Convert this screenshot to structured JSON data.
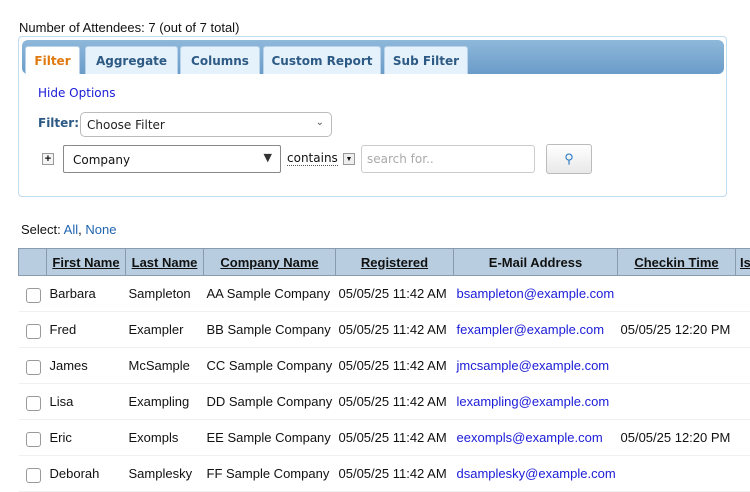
{
  "count_text": "Number of Attendees: 7 (out of 7 total)",
  "tabs": [
    {
      "label": "Filter",
      "active": true
    },
    {
      "label": "Aggregate"
    },
    {
      "label": "Columns"
    },
    {
      "label": "Custom Report"
    },
    {
      "label": "Sub Filter"
    }
  ],
  "hide_options": "Hide Options",
  "filter_label": "Filter:",
  "filter_select": "Choose Filter",
  "field_select": "Company",
  "operator": "contains",
  "search_placeholder": "search for..",
  "select": {
    "label": "Select:",
    "all": "All",
    "sep": ",",
    "none": "None"
  },
  "columns": [
    "First Name",
    "Last Name",
    "Company Name",
    "Registered",
    "E-Mail Address",
    "Checkin Time",
    "Is"
  ],
  "rows": [
    [
      "Barbara",
      "Sampleton",
      "AA Sample Company",
      "05/05/25 11:42 AM",
      "bsampleton@example.com",
      ""
    ],
    [
      "Fred",
      "Exampler",
      "BB Sample Company",
      "05/05/25 11:42 AM",
      "fexampler@example.com",
      "05/05/25 12:20 PM"
    ],
    [
      "James",
      "McSample",
      "CC Sample Company",
      "05/05/25 11:42 AM",
      "jmcsample@example.com",
      ""
    ],
    [
      "Lisa",
      "Exampling",
      "DD Sample Company",
      "05/05/25 11:42 AM",
      "lexampling@example.com",
      ""
    ],
    [
      "Eric",
      "Exompls",
      "EE Sample Company",
      "05/05/25 11:42 AM",
      "eexompls@example.com",
      "05/05/25 12:20 PM"
    ],
    [
      "Deborah",
      "Samplesky",
      "FF Sample Company",
      "05/05/25 11:42 AM",
      "dsamplesky@example.com",
      ""
    ]
  ]
}
